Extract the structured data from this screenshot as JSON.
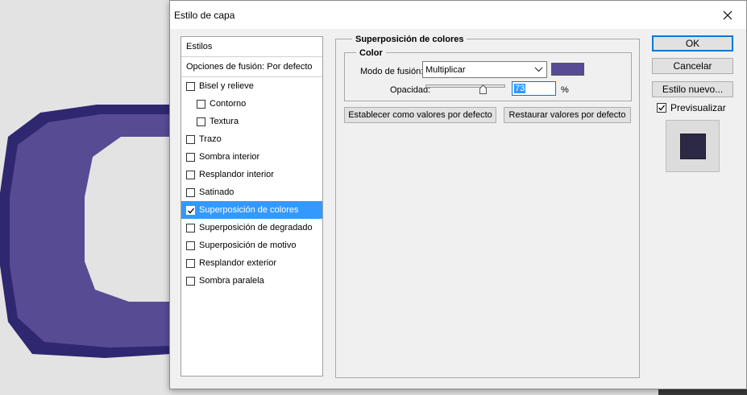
{
  "window": {
    "title": "Estilo de capa"
  },
  "styles_list": {
    "headers": [
      "Estilos",
      "Opciones de fusión: Por defecto"
    ],
    "items": [
      {
        "label": "Bisel y relieve",
        "checked": false,
        "indent": false,
        "selected": false
      },
      {
        "label": "Contorno",
        "checked": false,
        "indent": true,
        "selected": false
      },
      {
        "label": "Textura",
        "checked": false,
        "indent": true,
        "selected": false
      },
      {
        "label": "Trazo",
        "checked": false,
        "indent": false,
        "selected": false
      },
      {
        "label": "Sombra interior",
        "checked": false,
        "indent": false,
        "selected": false
      },
      {
        "label": "Resplandor interior",
        "checked": false,
        "indent": false,
        "selected": false
      },
      {
        "label": "Satinado",
        "checked": false,
        "indent": false,
        "selected": false
      },
      {
        "label": "Superposición de colores",
        "checked": true,
        "indent": false,
        "selected": true
      },
      {
        "label": "Superposición de degradado",
        "checked": false,
        "indent": false,
        "selected": false
      },
      {
        "label": "Superposición de motivo",
        "checked": false,
        "indent": false,
        "selected": false
      },
      {
        "label": "Resplandor exterior",
        "checked": false,
        "indent": false,
        "selected": false
      },
      {
        "label": "Sombra paralela",
        "checked": false,
        "indent": false,
        "selected": false
      }
    ]
  },
  "overlay": {
    "group_title": "Superposición de colores",
    "color_group_title": "Color",
    "blend_label": "Modo de fusión:",
    "blend_value": "Multiplicar",
    "color": "#574b94",
    "opacity_label": "Opacidad:",
    "opacity_value": "73",
    "opacity_fraction": 0.73,
    "percent_sign": "%",
    "set_default_label": "Establecer como valores por defecto",
    "restore_default_label": "Restaurar valores por defecto"
  },
  "buttons": {
    "ok": "OK",
    "cancel": "Cancelar",
    "new_style": "Estilo nuevo...",
    "preview": "Previsualizar",
    "preview_checked": true
  },
  "colors": {
    "selection": "#3399ff",
    "accent": "#0078d7",
    "letter_fill": "#574b94",
    "letter_edge": "#2f2770",
    "preview_fill": "#2b2944"
  },
  "icons": [
    "close-icon",
    "chevron-down-icon",
    "slider-thumb-icon",
    "checkmark-icon"
  ]
}
